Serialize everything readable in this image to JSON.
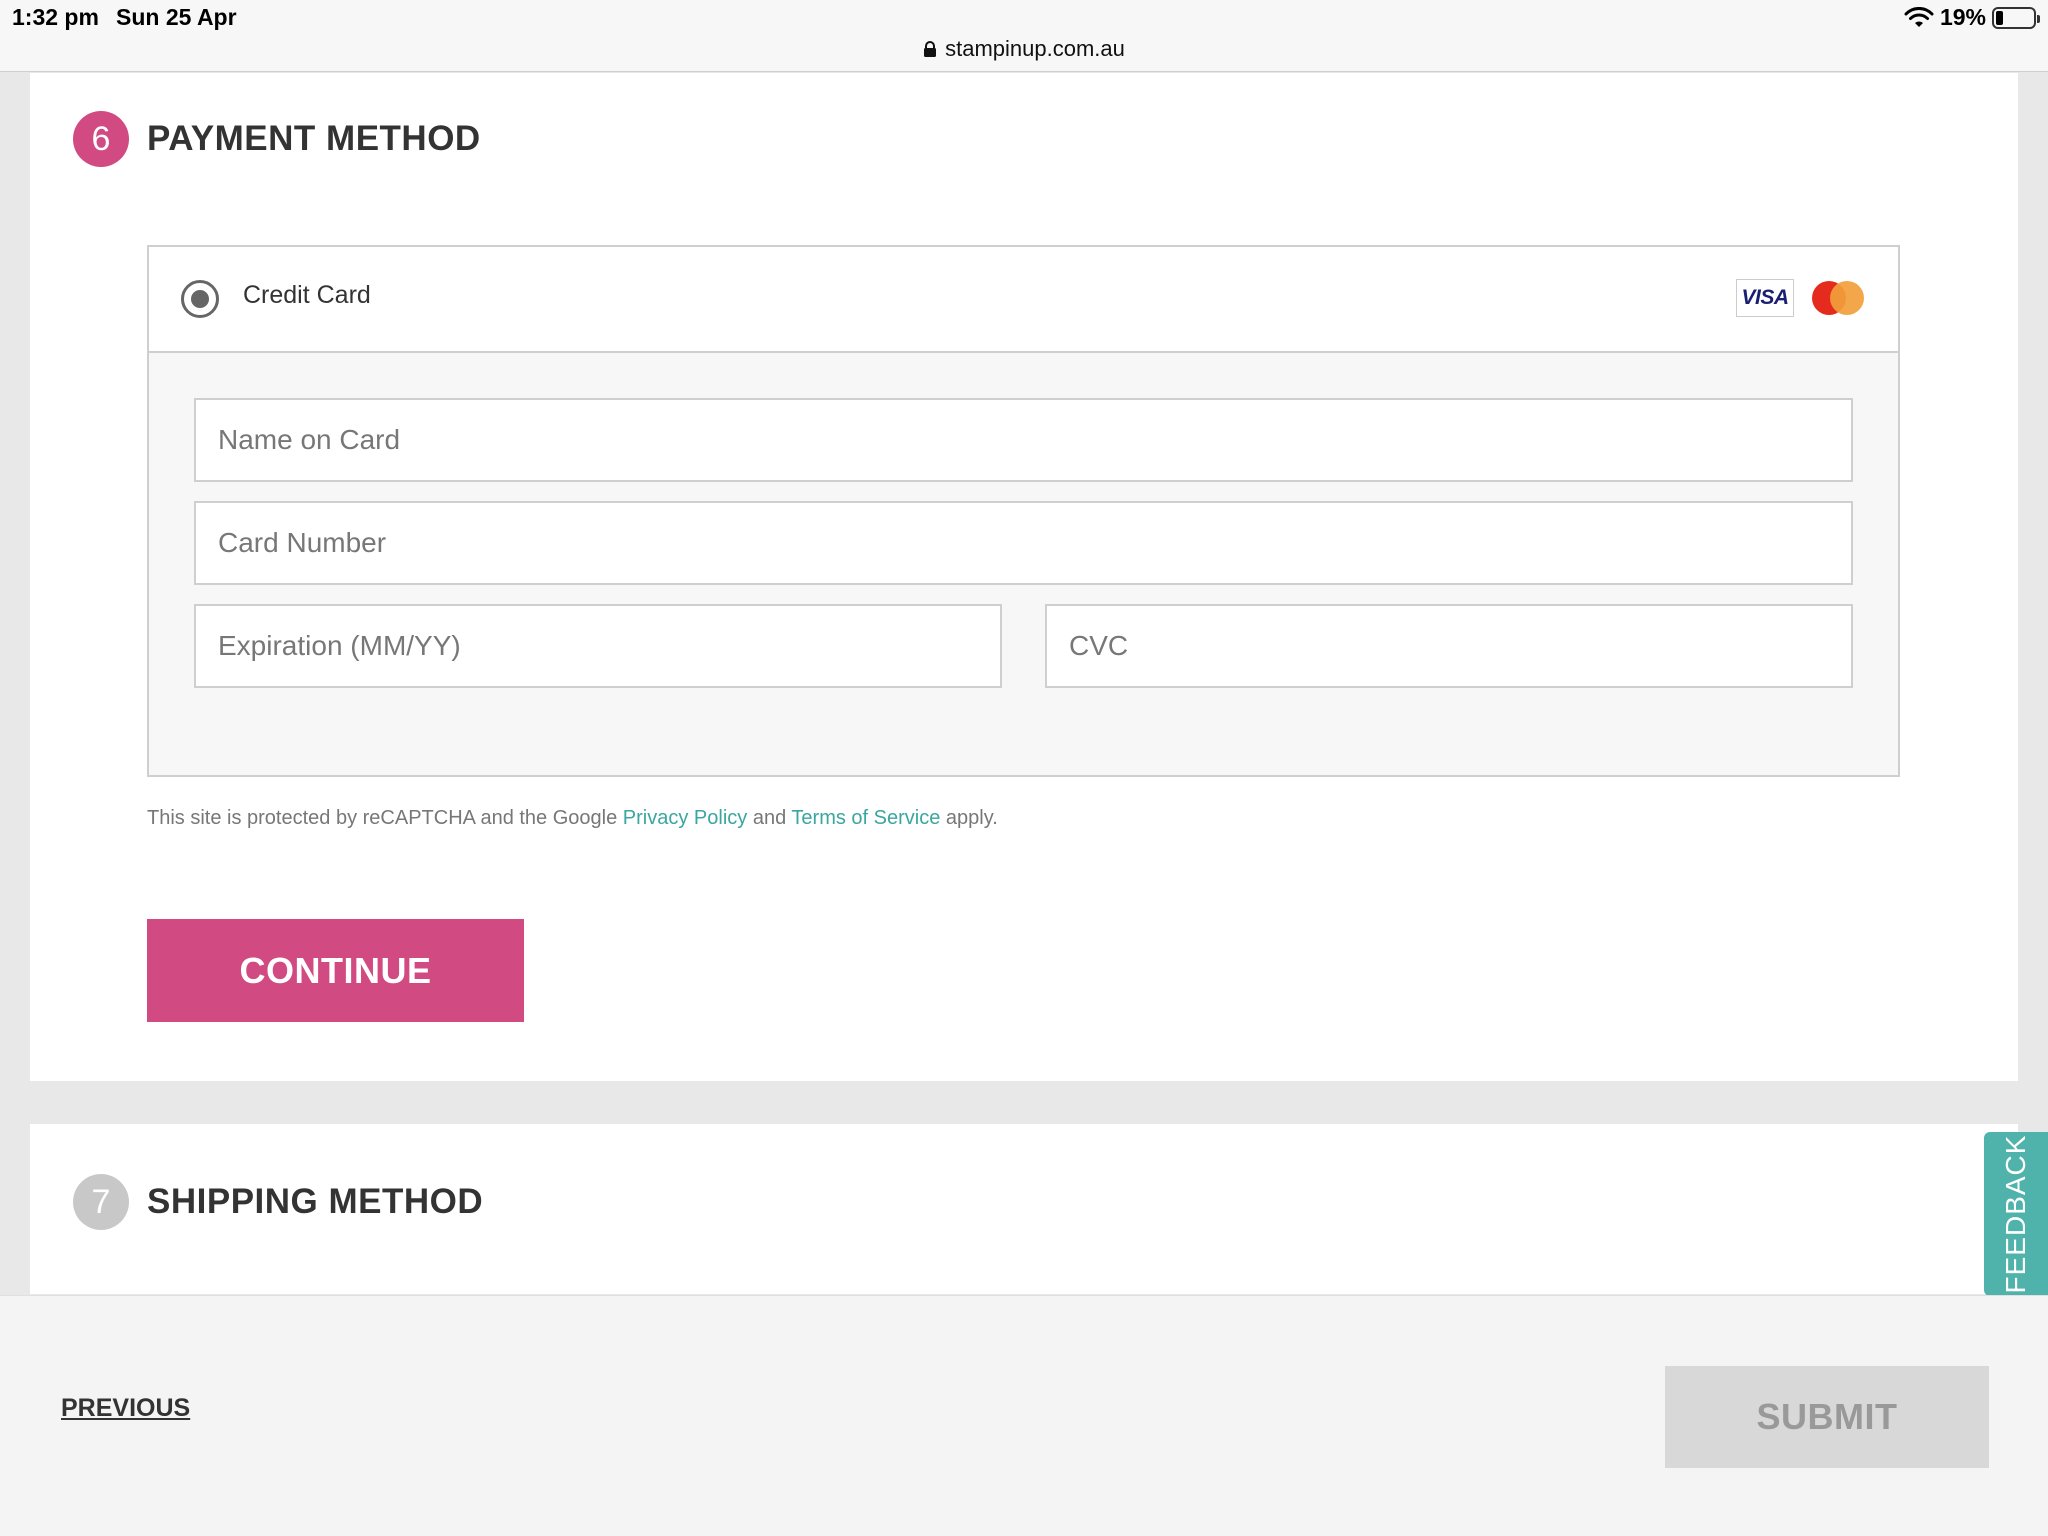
{
  "status_bar": {
    "time": "1:32 pm",
    "date": "Sun 25 Apr",
    "battery": "19%",
    "battery_level": 0.19,
    "url": "stampinup.com.au"
  },
  "payment_section": {
    "step_number": "6",
    "title": "PAYMENT METHOD",
    "option_label": "Credit Card",
    "option_selected": true,
    "card_brands": [
      "visa-logo",
      "mastercard-logo"
    ],
    "visa_text": "VISA",
    "fields": {
      "name_placeholder": "Name on Card",
      "number_placeholder": "Card Number",
      "expiration_placeholder": "Expiration (MM/YY)",
      "cvc_placeholder": "CVC"
    },
    "recaptcha": {
      "prefix": "This site is protected by reCAPTCHA and the Google",
      "privacy_link": "Privacy Policy",
      "middle": "and",
      "terms_link": "Terms of Service",
      "suffix": "apply."
    },
    "continue_label": "CONTINUE"
  },
  "shipping_section": {
    "step_number": "7",
    "title": "SHIPPING METHOD"
  },
  "feedback_tab": {
    "label": "FEEDBACK"
  },
  "footer": {
    "previous_label": "PREVIOUS",
    "submit_label": "SUBMIT"
  },
  "colors": {
    "brand_pink": "#d24a82",
    "link_teal": "#3aa6a0",
    "feedback_teal": "#4fb3ab",
    "disabled_gray": "#d8d8d8"
  }
}
